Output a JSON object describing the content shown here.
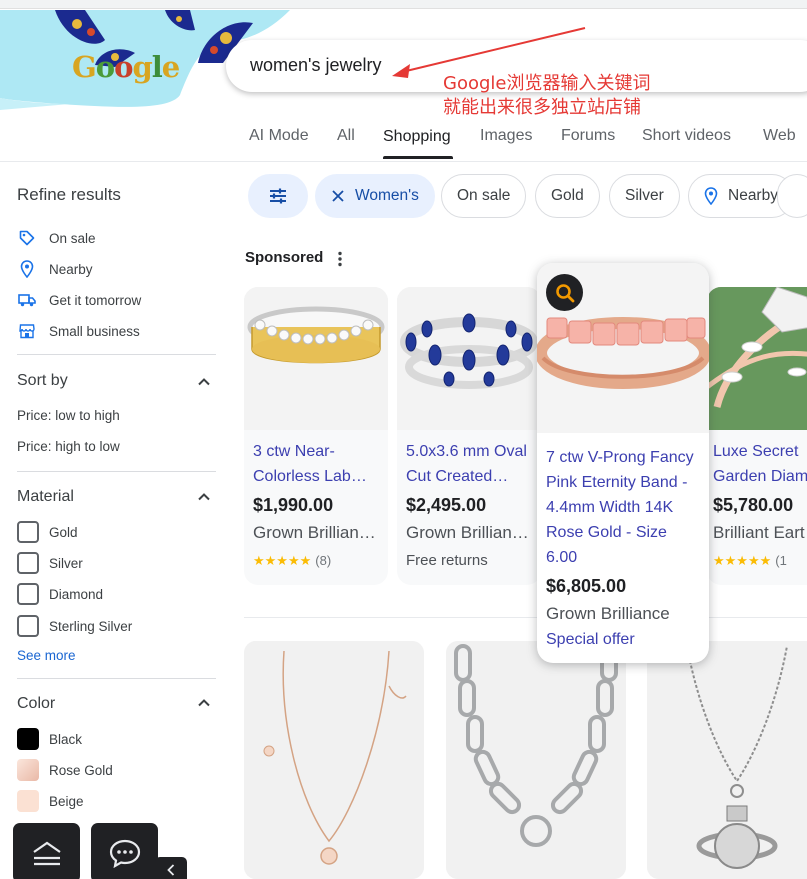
{
  "logo": {
    "text": "Google",
    "letters": [
      "G",
      "o",
      "o",
      "g",
      "l",
      "e"
    ]
  },
  "search": {
    "query": "women's jewelry"
  },
  "annotation": {
    "line1": "Google浏览器输入关键词",
    "line2": "就能出来很多独立站店铺",
    "color": "#e53935"
  },
  "tabs": [
    {
      "label": "AI Mode",
      "active": false
    },
    {
      "label": "All",
      "active": false
    },
    {
      "label": "Shopping",
      "active": true
    },
    {
      "label": "Images",
      "active": false
    },
    {
      "label": "Forums",
      "active": false
    },
    {
      "label": "Short videos",
      "active": false
    },
    {
      "label": "Web",
      "active": false
    }
  ],
  "sidebar": {
    "title": "Refine results",
    "quick_filters": [
      {
        "label": "On sale",
        "icon": "tag-icon"
      },
      {
        "label": "Nearby",
        "icon": "location-pin-icon"
      },
      {
        "label": "Get it tomorrow",
        "icon": "delivery-truck-icon"
      },
      {
        "label": "Small business",
        "icon": "storefront-icon"
      }
    ],
    "sort": {
      "title": "Sort by",
      "options": [
        "Price: low to high",
        "Price: high to low"
      ]
    },
    "material": {
      "title": "Material",
      "options": [
        "Gold",
        "Silver",
        "Diamond",
        "Sterling Silver"
      ],
      "see_more": "See more"
    },
    "color": {
      "title": "Color",
      "options": [
        {
          "label": "Black",
          "swatch": "#000000"
        },
        {
          "label": "Rose Gold",
          "swatch": "#f3d3c6"
        },
        {
          "label": "Beige",
          "swatch": "#fbe1d3"
        }
      ]
    }
  },
  "chips": [
    {
      "label": "",
      "icon": "filter-sliders-icon",
      "selected": true
    },
    {
      "label": "Women's",
      "icon": "close-icon",
      "selected": true
    },
    {
      "label": "On sale",
      "icon": "",
      "selected": false
    },
    {
      "label": "Gold",
      "icon": "",
      "selected": false
    },
    {
      "label": "Silver",
      "icon": "",
      "selected": false
    },
    {
      "label": "Nearby",
      "icon": "location-pin-icon",
      "selected": false
    }
  ],
  "sponsored": {
    "label": "Sponsored"
  },
  "sponsored_products": [
    {
      "title_line1": "3 ctw Near-",
      "title_line2": "Colorless Lab…",
      "price": "$1,990.00",
      "store": "Grown Brillian…",
      "stars": "★★★★★",
      "rating": 4.5,
      "rating_count": "(8)"
    },
    {
      "title_line1": "5.0x3.6 mm Oval",
      "title_line2": "Cut Created…",
      "price": "$2,495.00",
      "store": "Grown Brillian…",
      "extra": "Free returns"
    },
    {
      "title_lines": [
        "7 ctw V-Prong Fancy",
        "Pink Eternity Band -",
        "4.4mm Width 14K",
        "Rose Gold - Size",
        "6.00"
      ],
      "price": "$6,805.00",
      "store": "Grown Brilliance",
      "extra": "Special offer",
      "lens_icon": "lens-search-icon"
    },
    {
      "title_line1": "Luxe Secret",
      "title_line2": "Garden Diamo",
      "price": "$5,780.00",
      "store": "Brilliant Eart",
      "stars": "★★★★★",
      "rating": 5,
      "rating_count": "(1"
    }
  ]
}
